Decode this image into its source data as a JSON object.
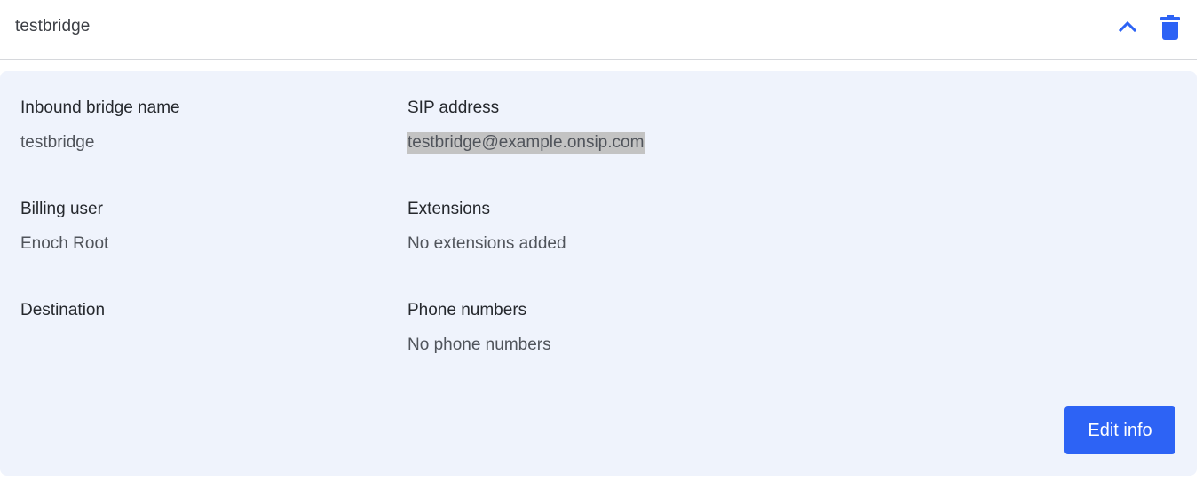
{
  "header": {
    "title": "testbridge",
    "collapse_icon": "chevron-up-icon",
    "delete_icon": "trash-icon",
    "accent_color": "#2d63f5"
  },
  "details": {
    "bridge_name": {
      "label": "Inbound bridge name",
      "value": "testbridge"
    },
    "sip_address": {
      "label": "SIP address",
      "value": "testbridge@example.onsip.com"
    },
    "billing_user": {
      "label": "Billing user",
      "value": "Enoch Root"
    },
    "extensions": {
      "label": "Extensions",
      "value": "No extensions added"
    },
    "destination": {
      "label": "Destination",
      "value": ""
    },
    "phone_numbers": {
      "label": "Phone numbers",
      "value": "No phone numbers"
    }
  },
  "actions": {
    "edit_label": "Edit info"
  }
}
